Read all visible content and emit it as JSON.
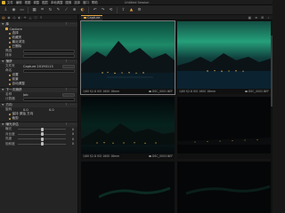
{
  "app": {
    "title": "Untitled Session",
    "menu": [
      "文件",
      "编辑",
      "视图",
      "调整",
      "图层",
      "本地调整",
      "图像",
      "选择",
      "窗口",
      "帮助"
    ]
  },
  "toolbar": {
    "icons": [
      "import-icon",
      "camera-icon",
      "folder-icon",
      "grid-icon",
      "crop-icon",
      "rotate-icon",
      "brush-icon",
      "eyedropper-icon",
      "picker-icon",
      "color-icon",
      "undo-icon",
      "redo-icon",
      "reset-icon",
      "export-icon",
      "share-icon",
      "settings-icon"
    ]
  },
  "left_panel": {
    "library": {
      "title": "库",
      "folder": "Capture",
      "items": [
        "选择",
        "收藏夹",
        "最近浏览",
        "已删除"
      ],
      "filter_label": "筛选",
      "sort_label": "排序"
    },
    "capture": {
      "title": "捕获",
      "folder_label": "文件夹",
      "folder_value": "Capture 20190113",
      "name_label": "命名",
      "option_items": [
        "设置",
        "前景",
        "自动调整"
      ]
    },
    "next_capture": {
      "title": "下一次捕获",
      "name_label": "名称",
      "value": "Job",
      "counter_label": "计数器"
    },
    "orientation": {
      "title": "方向",
      "label": "旋转",
      "value_a": "0.0",
      "value_b": "0.0",
      "options": [
        "保持 原始 方向",
        "裁剪"
      ]
    },
    "exposure": {
      "title": "曝光评估",
      "sliders": [
        {
          "label": "曝光",
          "value": "0",
          "pos": 0.5
        },
        {
          "label": "对比度",
          "value": "0",
          "pos": 0.5
        },
        {
          "label": "亮度",
          "value": "0",
          "pos": 0.5
        },
        {
          "label": "饱和度",
          "value": "0",
          "pos": 0.5
        }
      ]
    }
  },
  "browser": {
    "tab_label": "Capture",
    "thumbs": [
      {
        "left_meta": "1/60 f/2.8 ISO 1600  18mm",
        "right_meta": "DSC_0001.NEF"
      },
      {
        "left_meta": "1/60 f/2.8 ISO 1600  18mm",
        "right_meta": "DSC_0002.NEF"
      },
      {
        "left_meta": "1/60 f/2.8 ISO 1600  18mm",
        "right_meta": "DSC_0003.NEF"
      },
      {
        "left_meta": "",
        "right_meta": ""
      },
      {
        "left_meta": "",
        "right_meta": ""
      },
      {
        "left_meta": "",
        "right_meta": ""
      }
    ]
  }
}
